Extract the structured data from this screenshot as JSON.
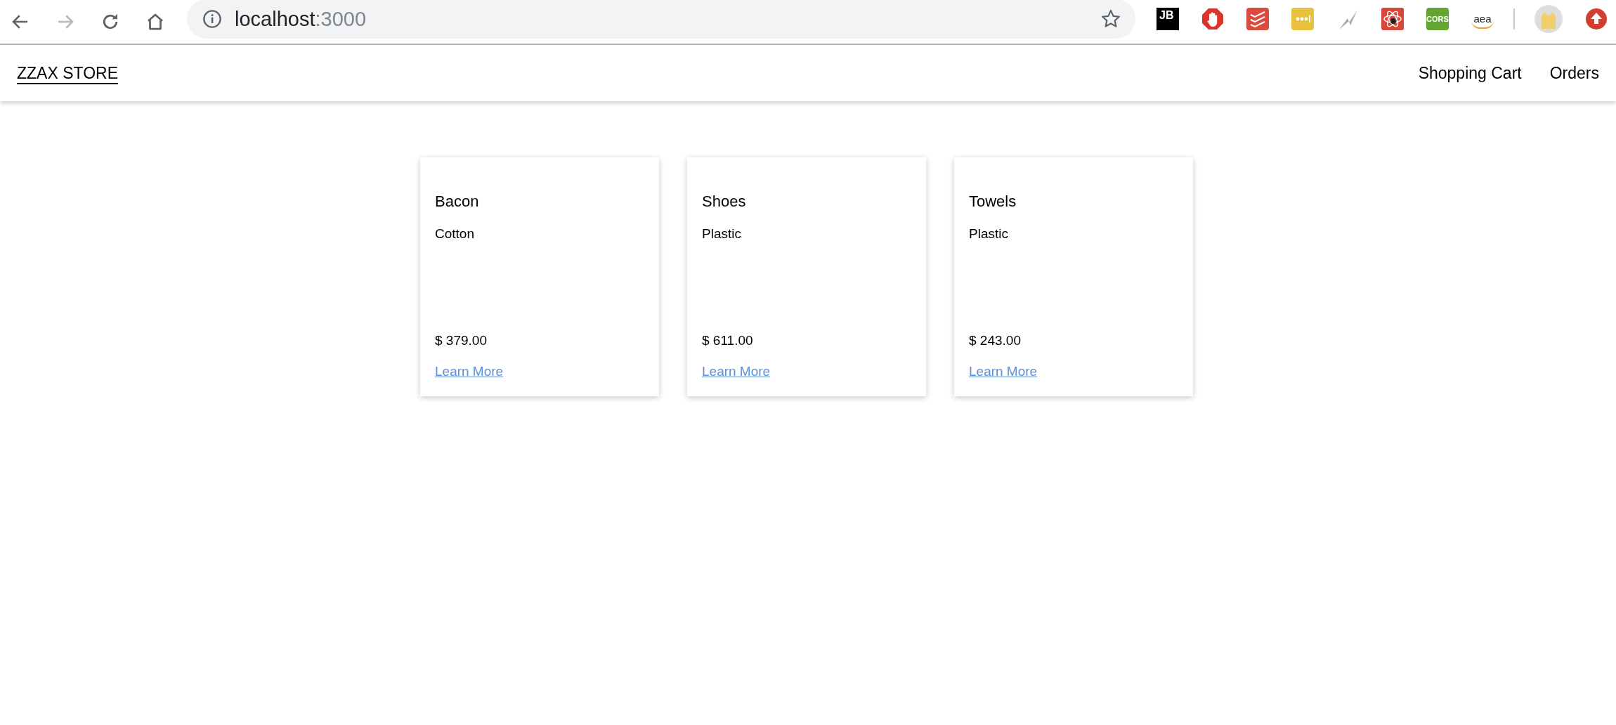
{
  "browser": {
    "url_host": "localhost",
    "url_port": ":3000",
    "forward_disabled": true,
    "extensions": [
      {
        "kind": "jetbrains",
        "label": "JB"
      },
      {
        "kind": "stop-hand"
      },
      {
        "kind": "checklist"
      },
      {
        "kind": "dots"
      },
      {
        "kind": "lightning"
      },
      {
        "kind": "atom"
      },
      {
        "kind": "cors",
        "label": "CORS"
      },
      {
        "kind": "amazon",
        "label": "aea"
      }
    ]
  },
  "navbar": {
    "brand": "ZZAX STORE",
    "links": [
      "Shopping Cart",
      "Orders"
    ]
  },
  "products": [
    {
      "name": "Bacon",
      "material": "Cotton",
      "price": "$ 379.00",
      "link": "Learn More"
    },
    {
      "name": "Shoes",
      "material": "Plastic",
      "price": "$ 611.00",
      "link": "Learn More"
    },
    {
      "name": "Towels",
      "material": "Plastic",
      "price": "$ 243.00",
      "link": "Learn More"
    }
  ]
}
